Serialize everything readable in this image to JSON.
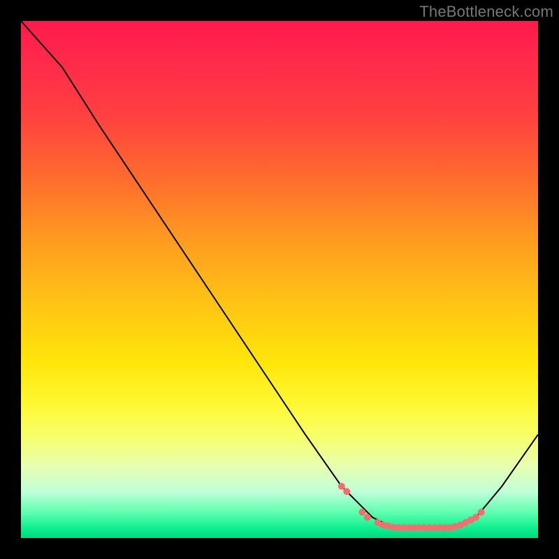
{
  "watermark": "TheBottleneck.com",
  "chart_data": {
    "type": "line",
    "title": "",
    "xlabel": "",
    "ylabel": "",
    "xlim": [
      0,
      100
    ],
    "ylim": [
      0,
      100
    ],
    "series": [
      {
        "name": "curve",
        "points": [
          {
            "x": 0,
            "y": 100
          },
          {
            "x": 8,
            "y": 91
          },
          {
            "x": 15,
            "y": 80
          },
          {
            "x": 25,
            "y": 65
          },
          {
            "x": 35,
            "y": 50
          },
          {
            "x": 45,
            "y": 35
          },
          {
            "x": 55,
            "y": 20
          },
          {
            "x": 62,
            "y": 10
          },
          {
            "x": 68,
            "y": 4
          },
          {
            "x": 72,
            "y": 2
          },
          {
            "x": 78,
            "y": 2
          },
          {
            "x": 84,
            "y": 2
          },
          {
            "x": 88,
            "y": 4
          },
          {
            "x": 93,
            "y": 10
          },
          {
            "x": 100,
            "y": 20
          }
        ]
      }
    ],
    "dots": [
      {
        "x": 62,
        "y": 10
      },
      {
        "x": 63,
        "y": 9
      },
      {
        "x": 66,
        "y": 5
      },
      {
        "x": 67,
        "y": 4
      },
      {
        "x": 69,
        "y": 3
      },
      {
        "x": 70,
        "y": 2.5
      },
      {
        "x": 71,
        "y": 2.3
      },
      {
        "x": 72,
        "y": 2.1
      },
      {
        "x": 73,
        "y": 2
      },
      {
        "x": 74,
        "y": 2
      },
      {
        "x": 75,
        "y": 2
      },
      {
        "x": 76,
        "y": 2
      },
      {
        "x": 77,
        "y": 2
      },
      {
        "x": 78,
        "y": 2
      },
      {
        "x": 79,
        "y": 2
      },
      {
        "x": 80,
        "y": 2
      },
      {
        "x": 81,
        "y": 2
      },
      {
        "x": 82,
        "y": 2
      },
      {
        "x": 83,
        "y": 2
      },
      {
        "x": 84,
        "y": 2.2
      },
      {
        "x": 85,
        "y": 2.5
      },
      {
        "x": 86,
        "y": 3
      },
      {
        "x": 87,
        "y": 3.5
      },
      {
        "x": 88,
        "y": 4
      },
      {
        "x": 89,
        "y": 5
      }
    ]
  }
}
